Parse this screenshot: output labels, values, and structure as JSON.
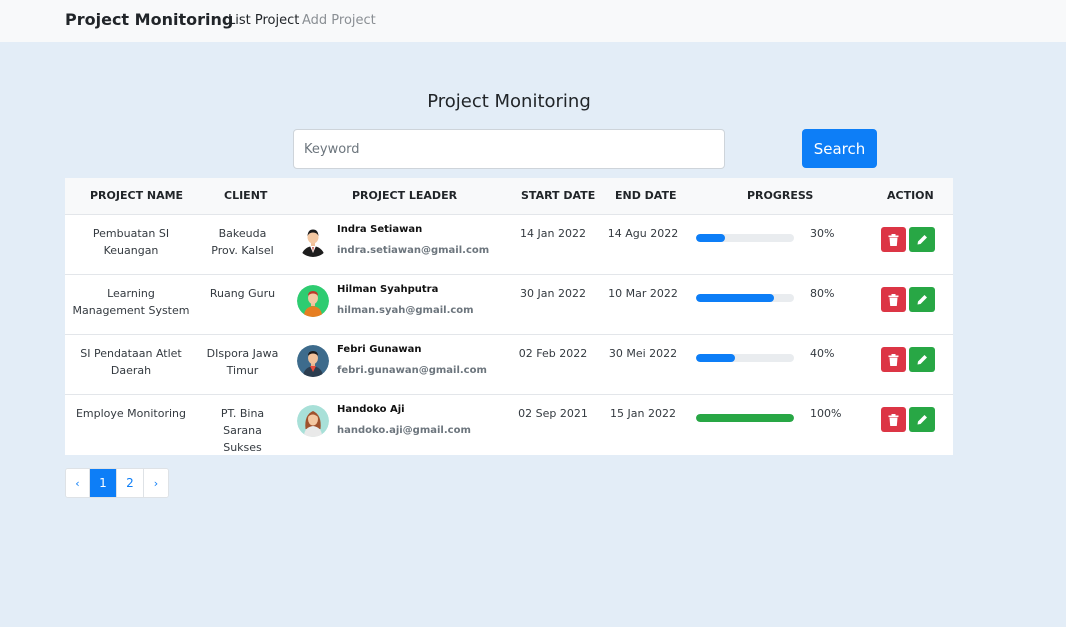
{
  "navbar": {
    "brand": "Project Monitoring",
    "links": [
      {
        "label": "List Project"
      },
      {
        "label": "Add Project"
      }
    ]
  },
  "page_title": "Project Monitoring",
  "search": {
    "placeholder": "Keyword",
    "value": "",
    "button_label": "Search"
  },
  "table": {
    "headers": [
      "PROJECT NAME",
      "CLIENT",
      "PROJECT LEADER",
      "START DATE",
      "END DATE",
      "PROGRESS",
      "ACTION"
    ],
    "rows": [
      {
        "project_name": "Pembuatan SI Keuangan",
        "client": "Bakeuda Prov. Kalsel",
        "leader_name": "Indra Setiawan",
        "leader_email": "indra.setiawan@gmail.com",
        "start_date": "14 Jan 2022",
        "end_date": "14 Agu 2022",
        "progress": 30,
        "progress_label": "30%"
      },
      {
        "project_name": "Learning Management System",
        "client": "Ruang Guru",
        "leader_name": "Hilman Syahputra",
        "leader_email": "hilman.syah@gmail.com",
        "start_date": "30 Jan 2022",
        "end_date": "10 Mar 2022",
        "progress": 80,
        "progress_label": "80%"
      },
      {
        "project_name": "SI Pendataan Atlet Daerah",
        "client": "DIspora Jawa Timur",
        "leader_name": "Febri Gunawan",
        "leader_email": "febri.gunawan@gmail.com",
        "start_date": "02 Feb 2022",
        "end_date": "30 Mei 2022",
        "progress": 40,
        "progress_label": "40%"
      },
      {
        "project_name": "Employe Monitoring",
        "client": "PT. Bina Sarana Sukses",
        "leader_name": "Handoko Aji",
        "leader_email": "handoko.aji@gmail.com",
        "start_date": "02 Sep 2021",
        "end_date": "15 Jan 2022",
        "progress": 100,
        "progress_label": "100%"
      }
    ]
  },
  "pagination": {
    "prev": "‹",
    "pages": [
      "1",
      "2"
    ],
    "active": "1",
    "next": "›"
  },
  "colors": {
    "primary": "#0d7ef7",
    "danger": "#dc3545",
    "success": "#28a745",
    "background": "#e3edf7"
  },
  "icons": {
    "delete": "trash-icon",
    "edit": "pencil-icon"
  }
}
